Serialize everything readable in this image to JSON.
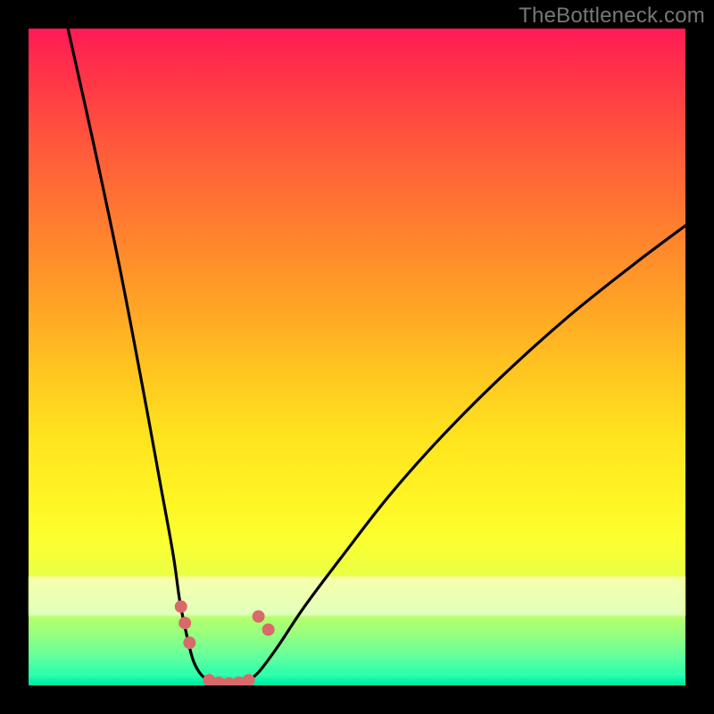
{
  "watermark": "TheBottleneck.com",
  "chart_data": {
    "type": "line",
    "title": "",
    "xlabel": "",
    "ylabel": "",
    "xlim": [
      0,
      100
    ],
    "ylim": [
      0,
      100
    ],
    "background_gradient": {
      "top": "#ff1a55",
      "mid": "#fff525",
      "bottom": "#00ffb0"
    },
    "series": [
      {
        "name": "left-curve",
        "color": "#000000",
        "x": [
          6,
          10,
          14,
          18,
          20,
          22,
          23,
          24,
          25,
          26,
          27,
          28
        ],
        "y": [
          100,
          82,
          63,
          42,
          31,
          20,
          13,
          8,
          4,
          2,
          1,
          0.5
        ]
      },
      {
        "name": "right-curve",
        "color": "#000000",
        "x": [
          33,
          35,
          38,
          42,
          48,
          55,
          63,
          72,
          82,
          92,
          100
        ],
        "y": [
          0.5,
          2,
          6,
          12,
          20,
          29,
          38,
          47,
          56,
          64,
          70
        ]
      },
      {
        "name": "floor-link",
        "color": "#d86a6a",
        "x": [
          28,
          29,
          30,
          31,
          32,
          33
        ],
        "y": [
          0.5,
          0.3,
          0.3,
          0.3,
          0.3,
          0.5
        ]
      }
    ],
    "markers": [
      {
        "name": "left-marker-1",
        "x": 23.2,
        "y": 12.0,
        "color": "#d86a6a"
      },
      {
        "name": "left-marker-2",
        "x": 23.8,
        "y": 9.5,
        "color": "#d86a6a"
      },
      {
        "name": "left-marker-3",
        "x": 24.5,
        "y": 6.5,
        "color": "#d86a6a"
      },
      {
        "name": "right-marker-1",
        "x": 35.0,
        "y": 10.5,
        "color": "#d86a6a"
      },
      {
        "name": "right-marker-2",
        "x": 36.5,
        "y": 8.5,
        "color": "#d86a6a"
      },
      {
        "name": "floor-marker-1",
        "x": 27.5,
        "y": 0.8,
        "color": "#d86a6a"
      },
      {
        "name": "floor-marker-2",
        "x": 29.0,
        "y": 0.4,
        "color": "#d86a6a"
      },
      {
        "name": "floor-marker-3",
        "x": 30.5,
        "y": 0.3,
        "color": "#d86a6a"
      },
      {
        "name": "floor-marker-4",
        "x": 32.0,
        "y": 0.4,
        "color": "#d86a6a"
      },
      {
        "name": "floor-marker-5",
        "x": 33.5,
        "y": 0.8,
        "color": "#d86a6a"
      }
    ]
  }
}
